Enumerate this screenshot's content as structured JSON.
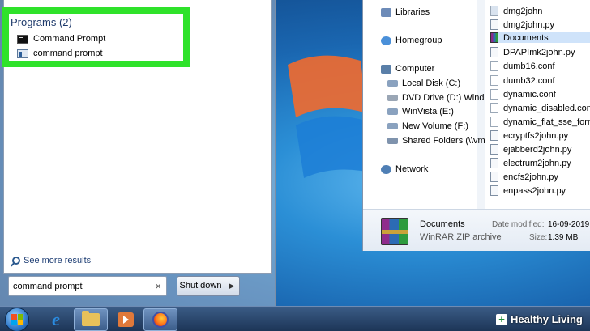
{
  "start_menu": {
    "programs_header": "Programs (2)",
    "programs": [
      {
        "label": "Command Prompt",
        "icon": "cmd-icon"
      },
      {
        "label": "command prompt",
        "icon": "shortcut-icon"
      }
    ],
    "see_more": "See more results",
    "search_value": "command prompt",
    "clear_glyph": "×",
    "shutdown_label": "Shut down",
    "shutdown_arrow": "▶"
  },
  "explorer": {
    "nav": [
      {
        "label": "Libraries",
        "icon": "libraries-icon",
        "color": "#6d8bb8"
      },
      {
        "label": "Homegroup",
        "icon": "homegroup-icon",
        "color": "#4a90d9"
      },
      {
        "label": "Computer",
        "icon": "computer-icon",
        "color": "#5a7fa8"
      },
      {
        "label": "Local Disk (C:)",
        "icon": "disk-icon",
        "color": "#8aa2bf"
      },
      {
        "label": "DVD Drive (D:) Windo",
        "icon": "dvd-icon",
        "color": "#9aa6b5"
      },
      {
        "label": "WinVista (E:)",
        "icon": "disk-icon",
        "color": "#8aa2bf"
      },
      {
        "label": "New Volume (F:)",
        "icon": "disk-icon",
        "color": "#8aa2bf"
      },
      {
        "label": "Shared Folders (\\\\vm",
        "icon": "network-drive-icon",
        "color": "#7f93ad"
      },
      {
        "label": "Network",
        "icon": "network-icon",
        "color": "#4f7fb5"
      }
    ],
    "files": [
      {
        "name": "dmg2john",
        "type": "exe"
      },
      {
        "name": "dmg2john.py",
        "type": "py"
      },
      {
        "name": "Documents",
        "type": "rar"
      },
      {
        "name": "DPAPImk2john.py",
        "type": "py"
      },
      {
        "name": "dumb16.conf",
        "type": "file"
      },
      {
        "name": "dumb32.conf",
        "type": "file"
      },
      {
        "name": "dynamic.conf",
        "type": "file"
      },
      {
        "name": "dynamic_disabled.conf",
        "type": "file"
      },
      {
        "name": "dynamic_flat_sse_formats",
        "type": "file"
      },
      {
        "name": "ecryptfs2john.py",
        "type": "py"
      },
      {
        "name": "ejabberd2john.py",
        "type": "py"
      },
      {
        "name": "electrum2john.py",
        "type": "py"
      },
      {
        "name": "encfs2john.py",
        "type": "py"
      },
      {
        "name": "enpass2john.py",
        "type": "py"
      }
    ],
    "details": {
      "name": "Documents",
      "type": "WinRAR ZIP archive",
      "date_label": "Date modified:",
      "date_value": "16-09-2019",
      "size_label": "Size:",
      "size_value": "1.39 MB"
    }
  },
  "taskbar": {
    "buttons": [
      "internet-explorer",
      "windows-explorer",
      "media-player",
      "firefox"
    ]
  },
  "watermark": {
    "plus": "+",
    "text": "Healthy Living"
  },
  "colors": {
    "highlight": "#2fe22a",
    "taskbar": "#1d3557"
  }
}
